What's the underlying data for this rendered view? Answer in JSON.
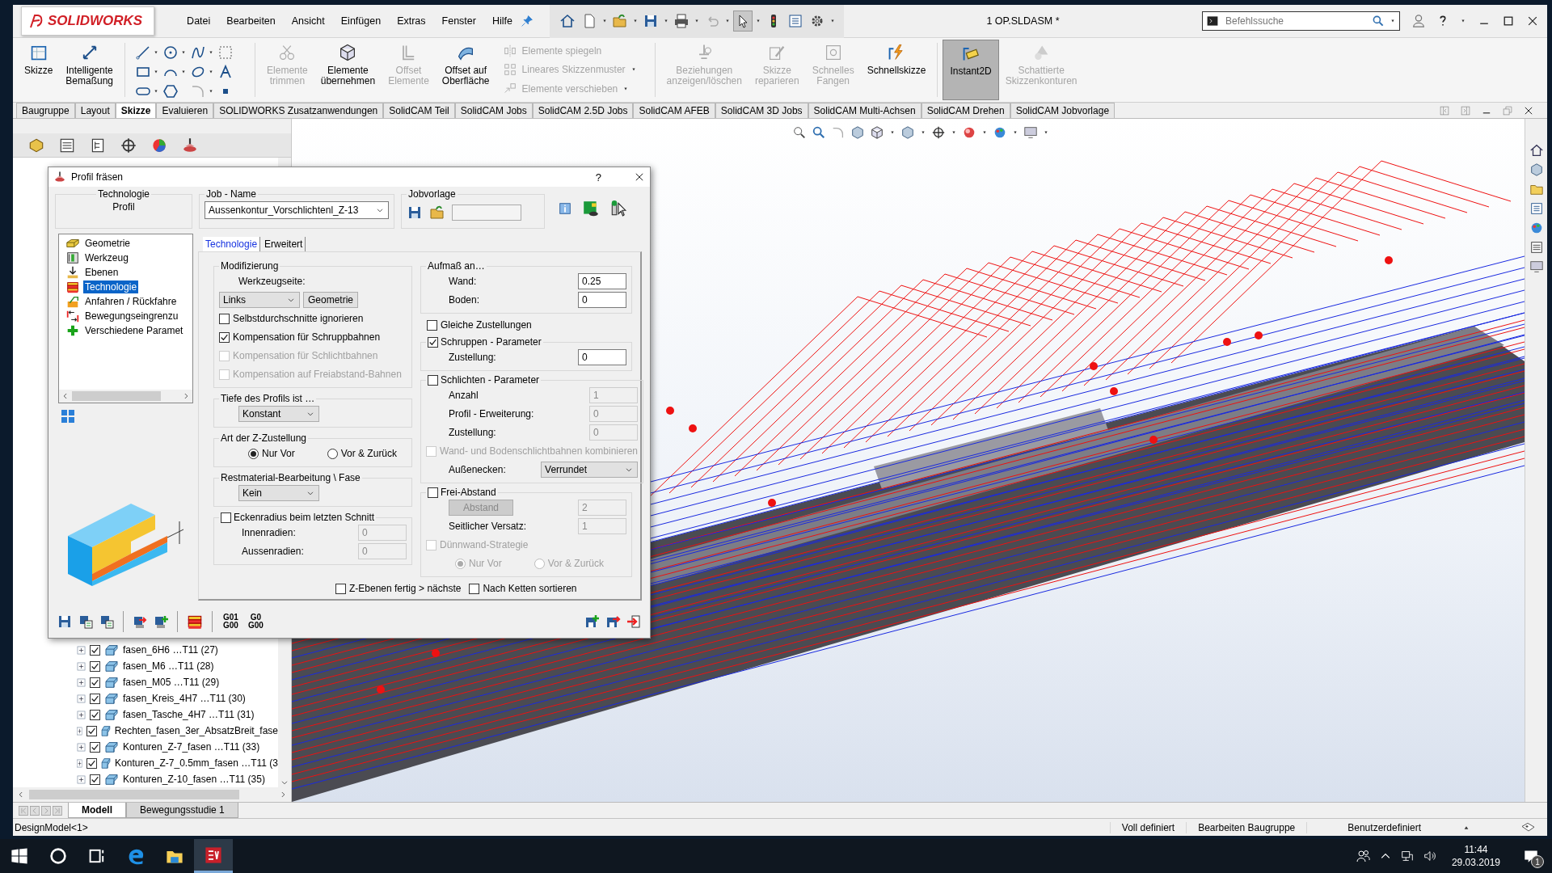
{
  "window": {
    "logo": "SOLIDWORKS",
    "title": "1 OP.SLDASM *",
    "search_placeholder": "Befehlssuche"
  },
  "menu": [
    "Datei",
    "Bearbeiten",
    "Ansicht",
    "Einfügen",
    "Extras",
    "Fenster",
    "Hilfe"
  ],
  "ribbon": [
    {
      "kind": "large",
      "label": "Skizze",
      "disabled": false,
      "pressed": false
    },
    {
      "kind": "large",
      "label": "Intelligente\nBemaßung",
      "disabled": false,
      "pressed": false
    },
    {
      "kind": "icon_grid"
    },
    {
      "kind": "large",
      "label": "Elemente\ntrimmen",
      "disabled": true,
      "pressed": false
    },
    {
      "kind": "large",
      "label": "Elemente\nübernehmen",
      "disabled": false,
      "pressed": false
    },
    {
      "kind": "large",
      "label": "Offset\nElemente",
      "disabled": true,
      "pressed": false
    },
    {
      "kind": "large",
      "label": "Offset auf\nOberfläche",
      "disabled": false,
      "pressed": false
    },
    {
      "kind": "list",
      "entries": [
        {
          "label": "Elemente spiegeln",
          "disabled": true
        },
        {
          "label": "Lineares Skizzenmuster",
          "disabled": true
        },
        {
          "label": "Elemente verschieben",
          "disabled": true
        }
      ]
    },
    {
      "kind": "large",
      "label": "Beziehungen\nanzeigen/löschen",
      "disabled": true,
      "pressed": false
    },
    {
      "kind": "large",
      "label": "Skizze\nreparieren",
      "disabled": true,
      "pressed": false
    },
    {
      "kind": "large",
      "label": "Schnelles\nFangen",
      "disabled": true,
      "pressed": false
    },
    {
      "kind": "large",
      "label": "Schnellskizze",
      "disabled": false,
      "pressed": false
    },
    {
      "kind": "large",
      "label": "Instant2D",
      "disabled": false,
      "pressed": true
    },
    {
      "kind": "large",
      "label": "Schattierte\nSkizzenkonturen",
      "disabled": true,
      "pressed": false
    }
  ],
  "command_tabs": [
    {
      "label": "Baugruppe",
      "selected": false
    },
    {
      "label": "Layout",
      "selected": false
    },
    {
      "label": "Skizze",
      "selected": true
    },
    {
      "label": "Evaluieren",
      "selected": false
    },
    {
      "label": "SOLIDWORKS Zusatzanwendungen",
      "selected": false
    },
    {
      "label": "SolidCAM Teil",
      "selected": false
    },
    {
      "label": "SolidCAM Jobs",
      "selected": false
    },
    {
      "label": "SolidCAM 2.5D Jobs",
      "selected": false
    },
    {
      "label": "SolidCAM AFEB",
      "selected": false
    },
    {
      "label": "SolidCAM 3D Jobs",
      "selected": false
    },
    {
      "label": "SolidCAM Multi-Achsen",
      "selected": false
    },
    {
      "label": "SolidCAM Drehen",
      "selected": false
    },
    {
      "label": "SolidCAM Jobvorlage",
      "selected": false
    }
  ],
  "feature_tree": [
    {
      "label": "fasen_6H6 …T11 (27)",
      "checked": true
    },
    {
      "label": "fasen_M6 …T11 (28)",
      "checked": true
    },
    {
      "label": "fasen_M05 …T11 (29)",
      "checked": true
    },
    {
      "label": "fasen_Kreis_4H7 …T11 (30)",
      "checked": true
    },
    {
      "label": "fasen_Tasche_4H7 …T11 (31)",
      "checked": true
    },
    {
      "label": "Rechten_fasen_3er_AbsatzBreit_fase",
      "checked": true
    },
    {
      "label": "Konturen_Z-7_fasen …T11 (33)",
      "checked": true
    },
    {
      "label": "Konturen_Z-7_0.5mm_fasen …T11 (3",
      "checked": true
    },
    {
      "label": "Konturen_Z-10_fasen …T11 (35)",
      "checked": true
    }
  ],
  "dialog": {
    "title": "Profil fräsen",
    "help": "?",
    "technology": {
      "legend": "Technologie",
      "value": "Profil"
    },
    "job_name": {
      "legend": "Job - Name",
      "value": "Aussenkontur_Vorschlichtenl_Z-13"
    },
    "job_template": {
      "legend": "Jobvorlage"
    },
    "tree": [
      {
        "label": "Geometrie",
        "selected": false
      },
      {
        "label": "Werkzeug",
        "selected": false
      },
      {
        "label": "Ebenen",
        "selected": false
      },
      {
        "label": "Technologie",
        "selected": true
      },
      {
        "label": "Anfahren / Rückfahre",
        "selected": false
      },
      {
        "label": "Bewegungseingrenzu",
        "selected": false
      },
      {
        "label": "Verschiedene Paramet",
        "selected": false
      }
    ],
    "tabs": [
      {
        "label": "Technologie",
        "selected": true
      },
      {
        "label": "Erweitert",
        "selected": false
      }
    ],
    "left_groups": [
      {
        "kind": "group",
        "legend": "Modifizierung",
        "rows": [
          {
            "kind": "caption",
            "text": "Werkzeugseite:"
          },
          {
            "kind": "select",
            "value": "Links",
            "button": "Geometrie"
          },
          {
            "kind": "checkbox",
            "label": "Selbstdurchschnitte ignorieren",
            "checked": false,
            "disabled": false
          },
          {
            "kind": "checkbox",
            "label": "Kompensation für Schruppbahnen",
            "checked": true,
            "disabled": false
          },
          {
            "kind": "checkbox",
            "label": "Kompensation für Schlichtbahnen",
            "checked": false,
            "disabled": true
          },
          {
            "kind": "checkbox",
            "label": "Kompensation auf Freiabstand-Bahnen",
            "checked": false,
            "disabled": true
          }
        ]
      },
      {
        "kind": "group",
        "legend": "Tiefe des Profils ist …",
        "rows": [
          {
            "kind": "select",
            "value": "Konstant"
          }
        ]
      },
      {
        "kind": "group",
        "legend": "Art der Z-Zustellung",
        "rows": [
          {
            "kind": "radios",
            "disabled": false,
            "options": [
              {
                "label": "Nur Vor",
                "selected": true
              },
              {
                "label": "Vor & Zurück",
                "selected": false
              }
            ]
          }
        ]
      },
      {
        "kind": "group",
        "legend": "Restmaterial-Bearbeitung \\ Fase",
        "rows": [
          {
            "kind": "select",
            "value": "Kein"
          }
        ]
      },
      {
        "kind": "group",
        "legend": "Eckenradius beim letzten Schnitt",
        "checked": false,
        "rows": [
          {
            "kind": "field",
            "label": "Innenradien:",
            "value": "0",
            "disabled": true
          },
          {
            "kind": "field",
            "label": "Aussenradien:",
            "value": "0",
            "disabled": true
          }
        ]
      }
    ],
    "right_groups": [
      {
        "kind": "group",
        "legend": "Aufmaß an…",
        "rows": [
          {
            "kind": "field",
            "label": "Wand:",
            "value": "0.25",
            "disabled": false
          },
          {
            "kind": "field",
            "label": "Boden:",
            "value": "0",
            "disabled": false
          }
        ]
      },
      {
        "kind": "checkbox",
        "label": "Gleiche Zustellungen",
        "checked": false,
        "disabled": false
      },
      {
        "kind": "group",
        "legend": "Schruppen - Parameter",
        "checked": true,
        "rows": [
          {
            "kind": "field",
            "label": "Zustellung:",
            "value": "0",
            "disabled": false
          }
        ]
      },
      {
        "kind": "group",
        "legend": "Schlichten - Parameter",
        "checked": false,
        "rows": [
          {
            "kind": "field",
            "label": "Anzahl",
            "value": "1",
            "disabled": true
          },
          {
            "kind": "field",
            "label": "Profil - Erweiterung:",
            "value": "0",
            "disabled": true
          },
          {
            "kind": "field",
            "label": "Zustellung:",
            "value": "0",
            "disabled": true
          },
          {
            "kind": "checkbox",
            "label": "Wand- und Bodenschlichtbahnen kombinieren",
            "checked": false,
            "disabled": true
          },
          {
            "kind": "select",
            "label": "Außenecken:",
            "value": "Verrundet"
          }
        ]
      },
      {
        "kind": "group",
        "legend": "Frei-Abstand",
        "checked": false,
        "rows": [
          {
            "kind": "button_field",
            "button": "Abstand",
            "value": "2",
            "disabled": true
          },
          {
            "kind": "field",
            "label": "Seitlicher Versatz:",
            "value": "1",
            "disabled": true
          },
          {
            "kind": "checkbox",
            "label": "Dünnwand-Strategie",
            "checked": false,
            "disabled": true
          },
          {
            "kind": "radios",
            "disabled": true,
            "options": [
              {
                "label": "Nur Vor",
                "selected": true
              },
              {
                "label": "Vor & Zurück",
                "selected": false
              }
            ]
          }
        ]
      }
    ],
    "footer": [
      {
        "label": "Z-Ebenen fertig > nächste",
        "checked": false
      },
      {
        "label": "Nach Ketten sortieren",
        "checked": false
      }
    ],
    "gcode_buttons": [
      {
        "top": "G01",
        "bottom": "G00"
      },
      {
        "top": "G0",
        "bottom": "G00"
      }
    ]
  },
  "bottom_tabs": [
    {
      "label": "Modell",
      "selected": true
    },
    {
      "label": "Bewegungsstudie 1",
      "selected": false
    }
  ],
  "status_bar": {
    "left": "DesignModel<1>",
    "items": [
      "Voll definiert",
      "Bearbeiten Baugruppe",
      "Benutzerdefiniert"
    ]
  },
  "taskbar": {
    "time": "11:44",
    "date": "29.03.2019",
    "notifications": "1"
  }
}
